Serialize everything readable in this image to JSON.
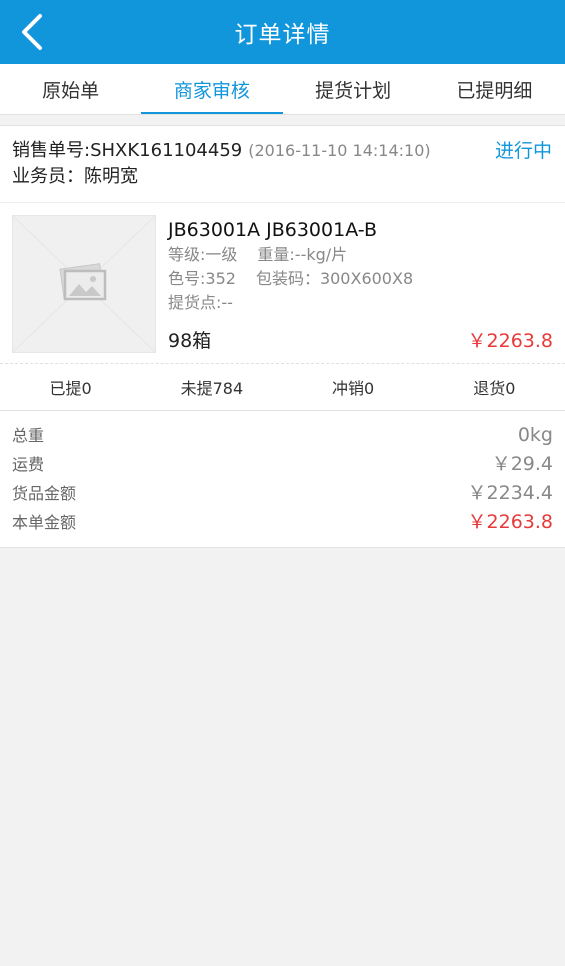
{
  "header": {
    "title": "订单详情"
  },
  "tabs": [
    "原始单",
    "商家审核",
    "提货计划",
    "已提明细"
  ],
  "order": {
    "number": "销售单号:SHXK161104459",
    "time": "(2016-11-10 14:14:10)",
    "status": "进行中",
    "salesperson": "业务员：陈明宽"
  },
  "product": {
    "image_icon": "image-placeholder-icon",
    "name": "JB63001A JB63001A-B",
    "grade": "等级:一级",
    "weight": "重量:--kg/片",
    "color_no": "色号:352",
    "pack_code": "包装码：300X600X8",
    "pickup_point": "提货点:--",
    "quantity": "98箱",
    "price": "￥2263.8"
  },
  "stats": [
    "已提0",
    "未提784",
    "冲销0",
    "退货0"
  ],
  "summary": [
    {
      "label": "总重",
      "value": "0kg"
    },
    {
      "label": "运费",
      "value": "￥29.4"
    },
    {
      "label": "货品金额",
      "value": "￥2234.4"
    },
    {
      "label": "本单金额",
      "value": "￥2263.8"
    }
  ],
  "colors": {
    "brand": "#1296db",
    "price": "#e83a3a"
  }
}
